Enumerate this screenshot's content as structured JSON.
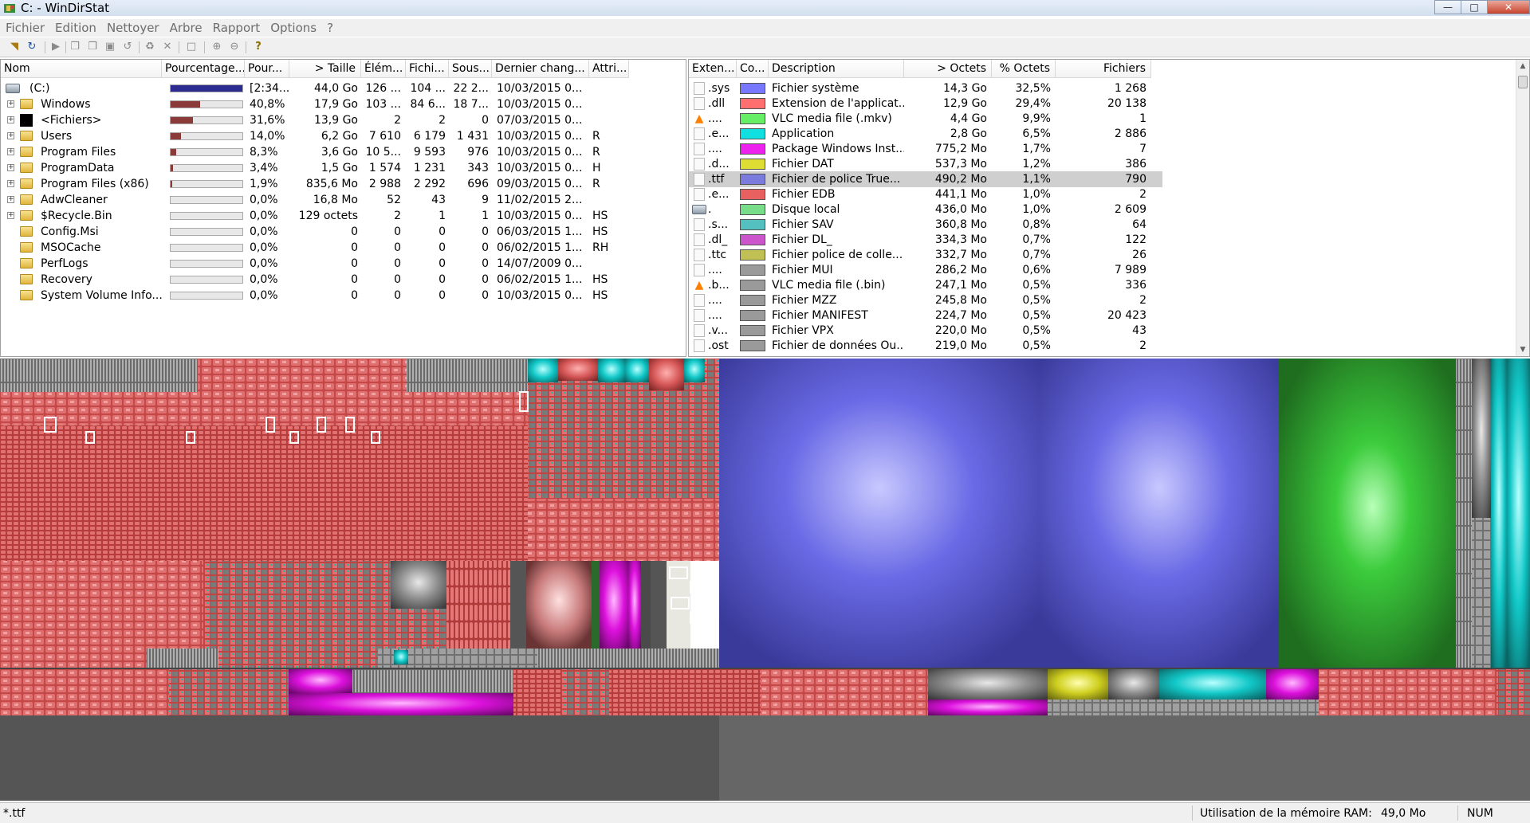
{
  "window": {
    "title": "C: - WinDirStat",
    "min": "—",
    "max": "□",
    "close": "✕"
  },
  "menu": [
    "Fichier",
    "Edition",
    "Nettoyer",
    "Arbre",
    "Rapport",
    "Options",
    "?"
  ],
  "toolbar_icons": [
    "open-icon",
    "refresh-icon",
    "play-icon",
    "copy-icon",
    "copy-path-icon",
    "explorer-icon",
    "refresh-selected-icon",
    "recycle-icon",
    "delete-icon",
    "new-folder-icon",
    "zoom-in-icon",
    "zoom-out-icon",
    "help-icon"
  ],
  "tree": {
    "headers": [
      "Nom",
      "Pourcentage...",
      "Pour...",
      "> Taille",
      "Élém...",
      "Fichi...",
      "Sous...",
      "Dernier chang...",
      "Attri..."
    ],
    "rows": [
      {
        "name": "(C:)",
        "icon": "drive",
        "pct": "[2:34...",
        "size": "44,0 Go",
        "items": "126 ...",
        "files": "104 ...",
        "subdirs": "22 2...",
        "date": "10/03/2015  0...",
        "attr": "",
        "fill": 1.0,
        "expander": false
      },
      {
        "name": "Windows",
        "icon": "folder",
        "pct": "40,8%",
        "size": "17,9 Go",
        "items": "103 ...",
        "files": "84 6...",
        "subdirs": "18 7...",
        "date": "10/03/2015  0...",
        "attr": "",
        "fill": 0.408,
        "expander": true
      },
      {
        "name": "<Fichiers>",
        "icon": "files",
        "pct": "31,6%",
        "size": "13,9 Go",
        "items": "2",
        "files": "2",
        "subdirs": "0",
        "date": "07/03/2015  0...",
        "attr": "",
        "fill": 0.316,
        "expander": true
      },
      {
        "name": "Users",
        "icon": "folder",
        "pct": "14,0%",
        "size": "6,2 Go",
        "items": "7 610",
        "files": "6 179",
        "subdirs": "1 431",
        "date": "10/03/2015  0...",
        "attr": "R",
        "fill": 0.14,
        "expander": true
      },
      {
        "name": "Program Files",
        "icon": "folder",
        "pct": "8,3%",
        "size": "3,6 Go",
        "items": "10 5...",
        "files": "9 593",
        "subdirs": "976",
        "date": "10/03/2015  0...",
        "attr": "R",
        "fill": 0.083,
        "expander": true
      },
      {
        "name": "ProgramData",
        "icon": "folder",
        "pct": "3,4%",
        "size": "1,5 Go",
        "items": "1 574",
        "files": "1 231",
        "subdirs": "343",
        "date": "10/03/2015  0...",
        "attr": "H",
        "fill": 0.034,
        "expander": true
      },
      {
        "name": "Program Files (x86)",
        "icon": "folder",
        "pct": "1,9%",
        "size": "835,6 Mo",
        "items": "2 988",
        "files": "2 292",
        "subdirs": "696",
        "date": "09/03/2015  0...",
        "attr": "R",
        "fill": 0.019,
        "expander": true
      },
      {
        "name": "AdwCleaner",
        "icon": "folder",
        "pct": "0,0%",
        "size": "16,8 Mo",
        "items": "52",
        "files": "43",
        "subdirs": "9",
        "date": "11/02/2015  2...",
        "attr": "",
        "fill": 0.0,
        "expander": true
      },
      {
        "name": "$Recycle.Bin",
        "icon": "folder",
        "pct": "0,0%",
        "size": "129 octets",
        "items": "2",
        "files": "1",
        "subdirs": "1",
        "date": "10/03/2015  0...",
        "attr": "HS",
        "fill": 0.0,
        "expander": true
      },
      {
        "name": "Config.Msi",
        "icon": "folder",
        "pct": "0,0%",
        "size": "0",
        "items": "0",
        "files": "0",
        "subdirs": "0",
        "date": "06/03/2015  1...",
        "attr": "HS",
        "fill": 0.0,
        "expander": false
      },
      {
        "name": "MSOCache",
        "icon": "folder",
        "pct": "0,0%",
        "size": "0",
        "items": "0",
        "files": "0",
        "subdirs": "0",
        "date": "06/02/2015  1...",
        "attr": "RH",
        "fill": 0.0,
        "expander": false
      },
      {
        "name": "PerfLogs",
        "icon": "folder",
        "pct": "0,0%",
        "size": "0",
        "items": "0",
        "files": "0",
        "subdirs": "0",
        "date": "14/07/2009  0...",
        "attr": "",
        "fill": 0.0,
        "expander": false
      },
      {
        "name": "Recovery",
        "icon": "folder",
        "pct": "0,0%",
        "size": "0",
        "items": "0",
        "files": "0",
        "subdirs": "0",
        "date": "06/02/2015  1...",
        "attr": "HS",
        "fill": 0.0,
        "expander": false
      },
      {
        "name": "System Volume Info...",
        "icon": "folder",
        "pct": "0,0%",
        "size": "0",
        "items": "0",
        "files": "0",
        "subdirs": "0",
        "date": "10/03/2015  0...",
        "attr": "HS",
        "fill": 0.0,
        "expander": false
      }
    ]
  },
  "extensions": {
    "headers": [
      "Exten...",
      "Co...",
      "Description",
      "> Octets",
      "% Octets",
      "Fichiers"
    ],
    "rows": [
      {
        "ext": ".sys",
        "color": "#7777ff",
        "desc": "Fichier système",
        "bytes": "14,3 Go",
        "pct": "32,5%",
        "files": "1 268",
        "icon": "file",
        "selected": false
      },
      {
        "ext": ".dll",
        "color": "#ff6f6f",
        "desc": "Extension de l'applicat...",
        "bytes": "12,9 Go",
        "pct": "29,4%",
        "files": "20 138",
        "icon": "file",
        "selected": false
      },
      {
        "ext": "....",
        "color": "#66ee66",
        "desc": "VLC media file (.mkv)",
        "bytes": "4,4 Go",
        "pct": "9,9%",
        "files": "1",
        "icon": "vlc",
        "selected": false
      },
      {
        "ext": ".e...",
        "color": "#11e0e0",
        "desc": "Application",
        "bytes": "2,8 Go",
        "pct": "6,5%",
        "files": "2 886",
        "icon": "file",
        "selected": false
      },
      {
        "ext": "....",
        "color": "#ee22ee",
        "desc": "Package Windows Inst...",
        "bytes": "775,2 Mo",
        "pct": "1,7%",
        "files": "7",
        "icon": "file",
        "selected": false
      },
      {
        "ext": ".d...",
        "color": "#dddd33",
        "desc": "Fichier DAT",
        "bytes": "537,3 Mo",
        "pct": "1,2%",
        "files": "386",
        "icon": "file",
        "selected": false
      },
      {
        "ext": ".ttf",
        "color": "#7b7bde",
        "desc": "Fichier de police True...",
        "bytes": "490,2 Mo",
        "pct": "1,1%",
        "files": "790",
        "icon": "file",
        "selected": true
      },
      {
        "ext": ".e...",
        "color": "#e86060",
        "desc": "Fichier EDB",
        "bytes": "441,1 Mo",
        "pct": "1,0%",
        "files": "2",
        "icon": "file",
        "selected": false
      },
      {
        "ext": ".",
        "color": "#77dd88",
        "desc": "Disque local",
        "bytes": "436,0 Mo",
        "pct": "1,0%",
        "files": "2 609",
        "icon": "drive",
        "selected": false
      },
      {
        "ext": ".s...",
        "color": "#55c0c0",
        "desc": "Fichier SAV",
        "bytes": "360,8 Mo",
        "pct": "0,8%",
        "files": "64",
        "icon": "file",
        "selected": false
      },
      {
        "ext": ".dl_",
        "color": "#cc55cc",
        "desc": "Fichier DL_",
        "bytes": "334,3 Mo",
        "pct": "0,7%",
        "files": "122",
        "icon": "file",
        "selected": false
      },
      {
        "ext": ".ttc",
        "color": "#c0c055",
        "desc": "Fichier police de colle...",
        "bytes": "332,7 Mo",
        "pct": "0,7%",
        "files": "26",
        "icon": "file",
        "selected": false
      },
      {
        "ext": "....",
        "color": "#9a9a9a",
        "desc": "Fichier MUI",
        "bytes": "286,2 Mo",
        "pct": "0,6%",
        "files": "7 989",
        "icon": "file",
        "selected": false
      },
      {
        "ext": ".b...",
        "color": "#9a9a9a",
        "desc": "VLC media file (.bin)",
        "bytes": "247,1 Mo",
        "pct": "0,5%",
        "files": "336",
        "icon": "vlc",
        "selected": false
      },
      {
        "ext": "....",
        "color": "#9a9a9a",
        "desc": "Fichier MZZ",
        "bytes": "245,8 Mo",
        "pct": "0,5%",
        "files": "2",
        "icon": "file",
        "selected": false
      },
      {
        "ext": "....",
        "color": "#9a9a9a",
        "desc": "Fichier MANIFEST",
        "bytes": "224,7 Mo",
        "pct": "0,5%",
        "files": "20 423",
        "icon": "file",
        "selected": false
      },
      {
        "ext": ".v...",
        "color": "#9a9a9a",
        "desc": "Fichier VPX",
        "bytes": "220,0 Mo",
        "pct": "0,5%",
        "files": "43",
        "icon": "file",
        "selected": false
      },
      {
        "ext": ".ost",
        "color": "#9a9a9a",
        "desc": "Fichier de données Ou...",
        "bytes": "219,0 Mo",
        "pct": "0,5%",
        "files": "2",
        "icon": "file",
        "selected": false
      }
    ]
  },
  "status": {
    "left": "*.ttf",
    "ram_label": "Utilisation de la mémoire RAM:",
    "ram_value": "49,0 Mo",
    "num": "NUM"
  },
  "colors": {
    "sys": "#5a5af0",
    "dll": "#e05656",
    "mkv": "#2fd02f",
    "exe": "#10c8c8",
    "msi": "#dd11dd",
    "dat": "#d0d020",
    "other": "#9a9a9a"
  }
}
